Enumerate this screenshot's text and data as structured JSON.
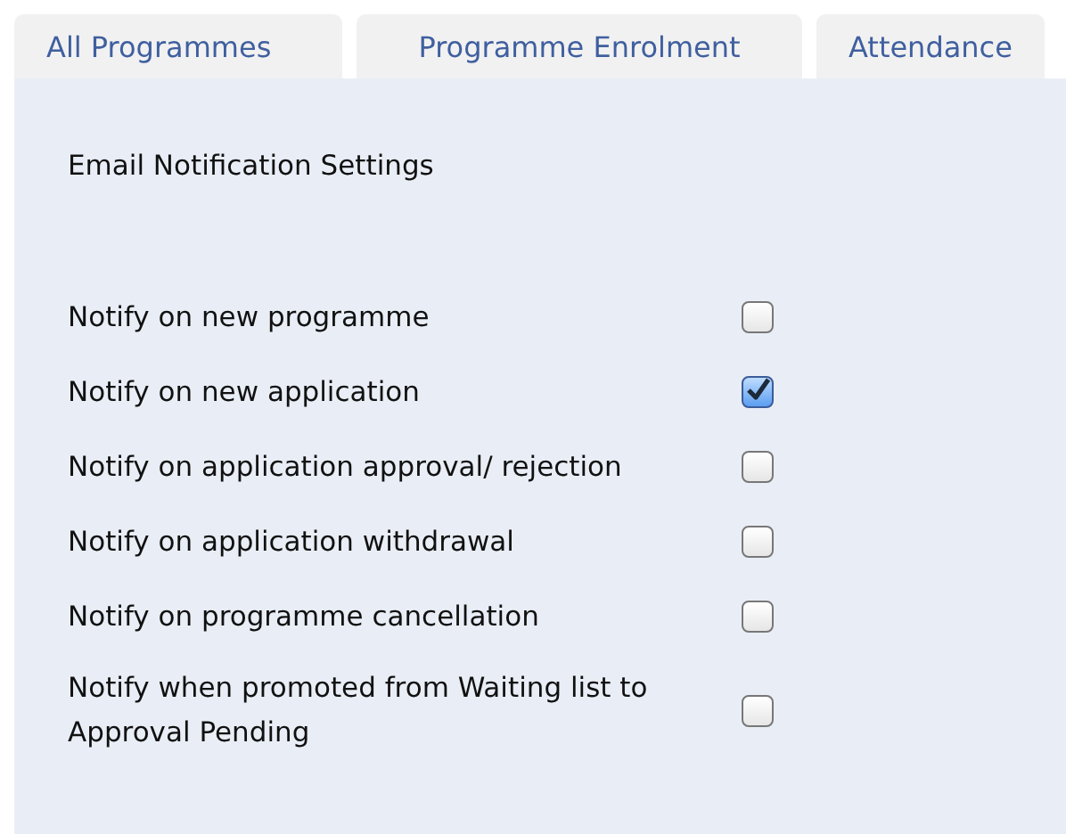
{
  "tabs": [
    {
      "label": "All Programmes",
      "selected": false
    },
    {
      "label": "Programme Enrolment",
      "selected": false
    },
    {
      "label": "Attendance",
      "selected": false
    }
  ],
  "panel": {
    "title": "Email Notification Settings",
    "settings": [
      {
        "label": "Notify on new programme",
        "checked": false
      },
      {
        "label": "Notify on new application",
        "checked": true
      },
      {
        "label": "Notify on application approval/ rejection",
        "checked": false
      },
      {
        "label": "Notify on application withdrawal",
        "checked": false
      },
      {
        "label": "Notify on programme cancellation",
        "checked": false
      },
      {
        "label": "Notify when promoted from Waiting list to Approval Pending",
        "checked": false
      }
    ]
  }
}
